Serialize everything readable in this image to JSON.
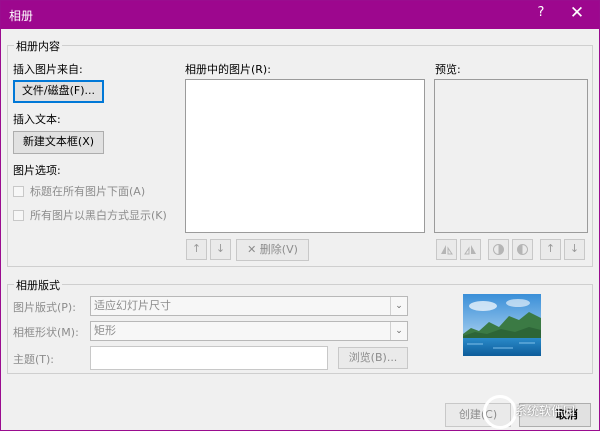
{
  "window": {
    "title": "相册",
    "help_glyph": "?",
    "close_glyph": "✕"
  },
  "album_content": {
    "group_title": "相册内容",
    "insert_from_label": "插入图片来自:",
    "file_disk_button": "文件/磁盘(F)...",
    "insert_text_label": "插入文本:",
    "new_textbox_button": "新建文本框(X)",
    "picture_options_label": "图片选项:",
    "caption_checkbox": "标题在所有图片下面(A)",
    "bw_checkbox": "所有图片以黑白方式显示(K)",
    "pictures_in_album_label": "相册中的图片(R):",
    "preview_label": "预览:",
    "move_up_glyph": "↑",
    "move_down_glyph": "↓",
    "delete_glyph": "✕",
    "delete_label": "删除(V)"
  },
  "album_layout": {
    "group_title": "相册版式",
    "picture_layout_label": "图片版式(P):",
    "picture_layout_value": "适应幻灯片尺寸",
    "frame_shape_label": "相框形状(M):",
    "frame_shape_value": "矩形",
    "theme_label": "主题(T):",
    "theme_value": "",
    "browse_button": "浏览(B)...",
    "dropdown_glyph": "⌄"
  },
  "footer": {
    "create_button": "创建(C)",
    "cancel_button": "取消"
  },
  "watermark_text": "系统软件园"
}
